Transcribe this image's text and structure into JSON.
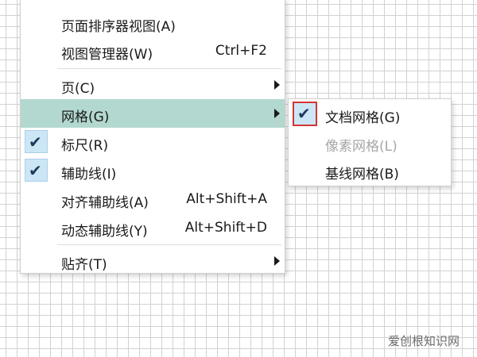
{
  "main_menu": {
    "items": [
      {
        "label": "页面排序器视图(A)",
        "shortcut": ""
      },
      {
        "label": "视图管理器(W)",
        "shortcut": "Ctrl+F2"
      },
      {
        "label": "页(C)",
        "shortcut": ""
      },
      {
        "label": "网格(G)",
        "shortcut": ""
      },
      {
        "label": "标尺(R)",
        "shortcut": ""
      },
      {
        "label": "辅助线(I)",
        "shortcut": ""
      },
      {
        "label": "对齐辅助线(A)",
        "shortcut": "Alt+Shift+A"
      },
      {
        "label": "动态辅助线(Y)",
        "shortcut": "Alt+Shift+D"
      },
      {
        "label": "贴齐(T)",
        "shortcut": ""
      }
    ]
  },
  "sub_menu": {
    "items": [
      {
        "label": "文档网格(G)",
        "checked": true,
        "enabled": true
      },
      {
        "label": "像素网格(L)",
        "checked": false,
        "enabled": false
      },
      {
        "label": "基线网格(B)",
        "checked": false,
        "enabled": true
      }
    ]
  },
  "watermark": "爱创根知识网",
  "colors": {
    "highlight": "#b3d8cf",
    "check_bg": "#cde6f6",
    "red_outline": "#d43434"
  }
}
